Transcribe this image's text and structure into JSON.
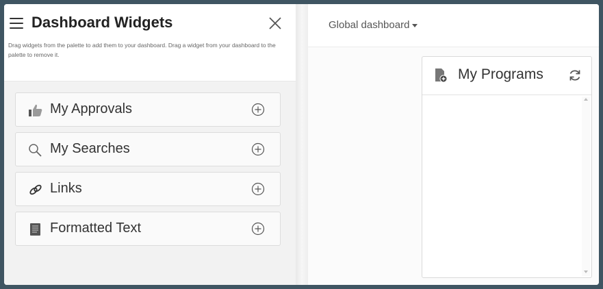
{
  "panel": {
    "title": "Dashboard Widgets",
    "description": "Drag widgets from the palette to add them to your dashboard. Drag a widget from your dashboard to the palette to remove it.",
    "items": [
      {
        "label": "My Approvals",
        "icon": "thumbs-up-icon"
      },
      {
        "label": "My Searches",
        "icon": "search-icon"
      },
      {
        "label": "Links",
        "icon": "link-icon"
      },
      {
        "label": "Formatted Text",
        "icon": "document-text-icon"
      }
    ]
  },
  "dashboard": {
    "selector_label": "Global dashboard",
    "widget": {
      "title": "My Programs",
      "icon": "program-file-icon"
    }
  },
  "colors": {
    "background_frame": "#3f5562",
    "panel_list_bg": "#f2f2f2",
    "text": "#333333"
  }
}
